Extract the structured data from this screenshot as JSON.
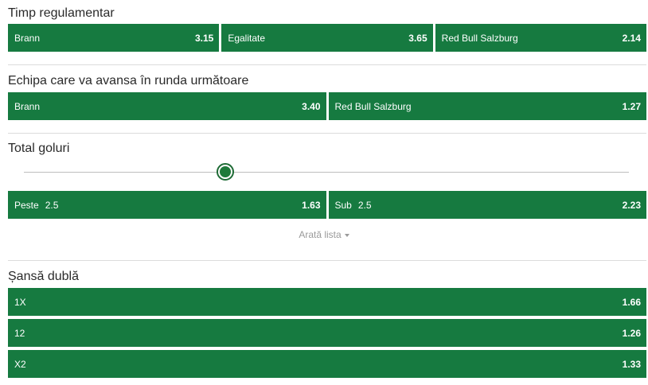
{
  "markets": {
    "regular_time": {
      "title": "Timp regulamentar",
      "outcomes": [
        {
          "label": "Brann",
          "odd": "3.15"
        },
        {
          "label": "Egalitate",
          "odd": "3.65"
        },
        {
          "label": "Red Bull Salzburg",
          "odd": "2.14"
        }
      ]
    },
    "to_advance": {
      "title": "Echipa care va avansa în runda următoare",
      "outcomes": [
        {
          "label": "Brann",
          "odd": "3.40"
        },
        {
          "label": "Red Bull Salzburg",
          "odd": "1.27"
        }
      ]
    },
    "total_goals": {
      "title": "Total goluri",
      "outcomes": [
        {
          "label": "Peste",
          "line": "2.5",
          "odd": "1.63"
        },
        {
          "label": "Sub",
          "line": "2.5",
          "odd": "2.23"
        }
      ],
      "show_list": "Arată lista"
    },
    "double_chance": {
      "title": "Șansă dublă",
      "outcomes": [
        {
          "label": "1X",
          "odd": "1.66"
        },
        {
          "label": "12",
          "odd": "1.26"
        },
        {
          "label": "X2",
          "odd": "1.33"
        }
      ]
    }
  },
  "colors": {
    "button_green": "#167a40",
    "slider_knob": "#1e7a3a"
  }
}
